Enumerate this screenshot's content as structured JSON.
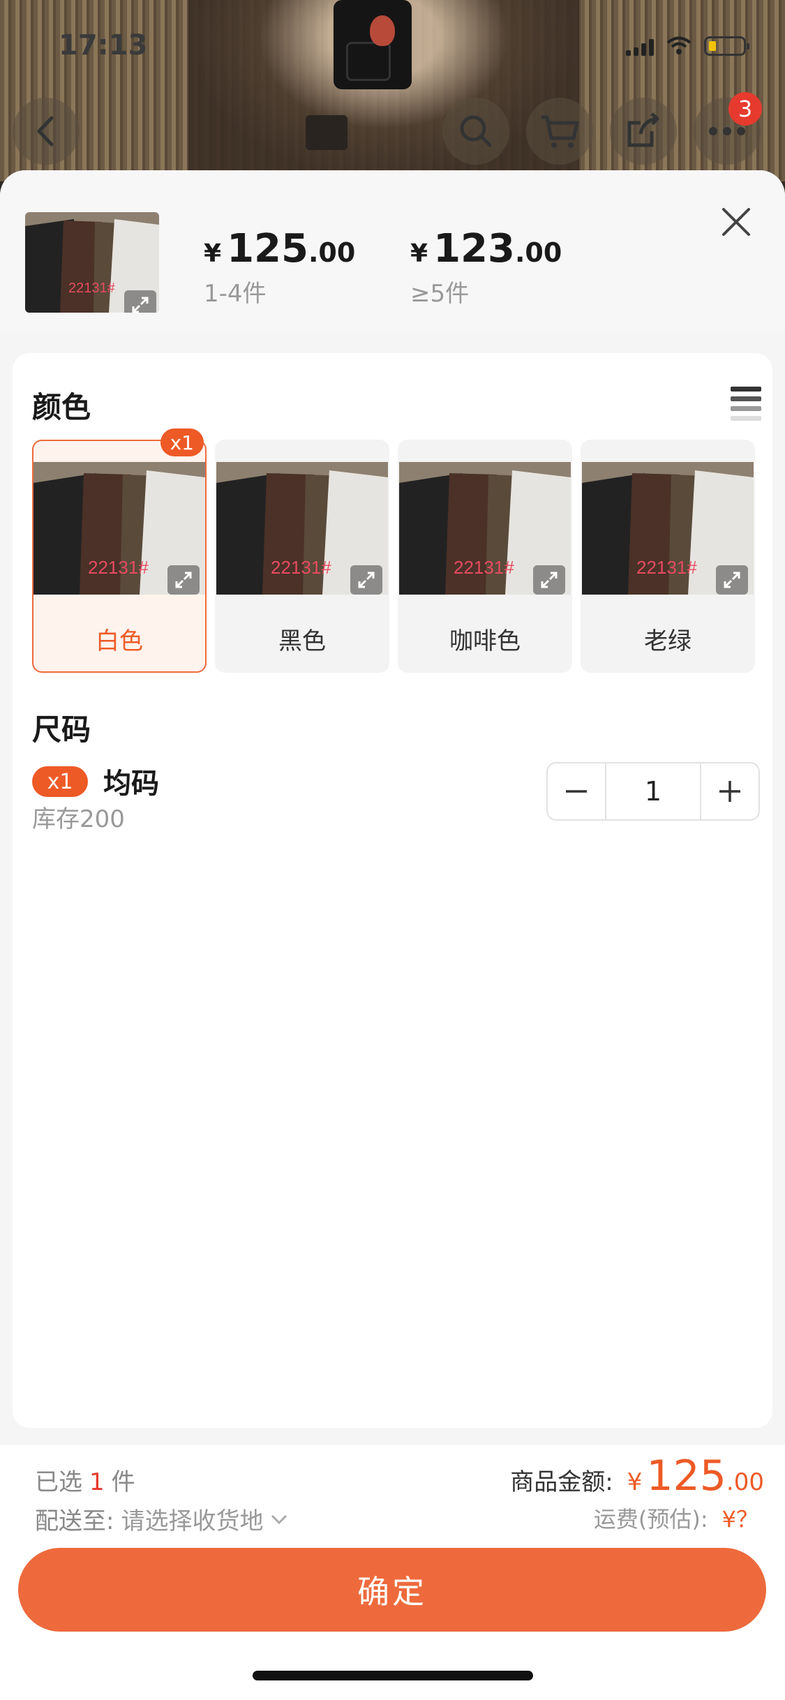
{
  "status": {
    "time": "17:13"
  },
  "nav": {
    "cart_count": "3"
  },
  "header": {
    "tiers": [
      {
        "yen": "¥",
        "int": "125",
        "dec": ".00",
        "range": "1-4件"
      },
      {
        "yen": "¥",
        "int": "123",
        "dec": ".00",
        "range": "≥5件"
      }
    ]
  },
  "color": {
    "title": "颜色",
    "options": [
      {
        "label": "白色",
        "badge": "x1",
        "selected": true
      },
      {
        "label": "黑色"
      },
      {
        "label": "咖啡色"
      },
      {
        "label": "老绿"
      }
    ]
  },
  "size": {
    "title": "尺码",
    "badge": "x1",
    "name": "均码",
    "stock": "库存200",
    "quantity": "1"
  },
  "footer": {
    "selected_prefix": "已选",
    "selected_count": "1",
    "selected_suffix": "件",
    "ship_label": "配送至:",
    "ship_value": "请选择收货地",
    "amount_label": "商品金额:",
    "amount_yen": "¥",
    "amount_int": "125",
    "amount_dec": ".00",
    "freight_label": "运费(预估):",
    "freight_value": "¥？",
    "confirm": "确定"
  },
  "colors": {
    "accent": "#EE6A3C",
    "badge": "#EE5A26",
    "cart_badge": "#E63A2E"
  },
  "icons": [
    "back-icon",
    "search-icon",
    "cart-icon",
    "share-icon",
    "more-icon",
    "close-icon",
    "expand-icon",
    "list-icon",
    "minus-icon",
    "plus-icon",
    "chevron-down-icon"
  ]
}
